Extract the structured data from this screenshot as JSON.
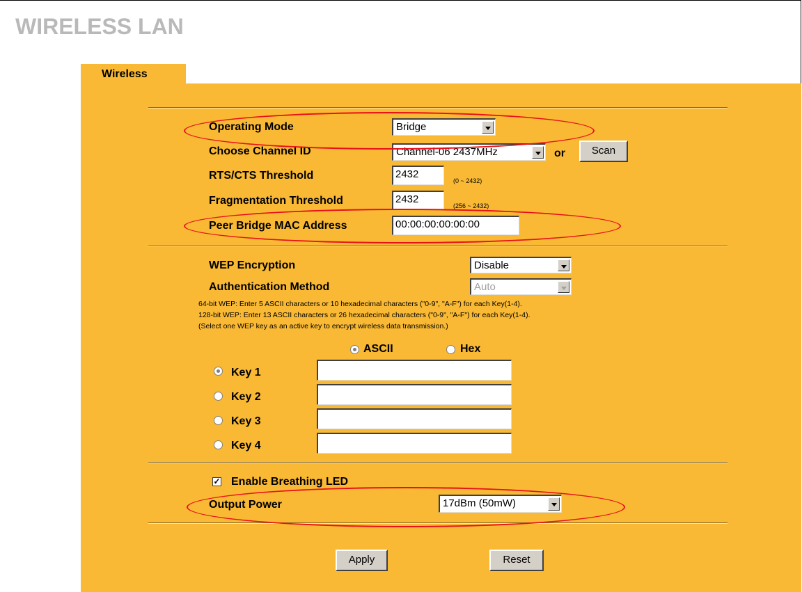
{
  "page": {
    "title": "WIRELESS LAN"
  },
  "tabs": [
    {
      "label": "Wireless"
    }
  ],
  "wireless": {
    "operating_mode_label": "Operating Mode",
    "operating_mode_value": "Bridge",
    "channel_label": "Choose Channel ID",
    "channel_value": "Channel-06 2437MHz",
    "or_text": "or",
    "scan_label": "Scan",
    "rts_label": "RTS/CTS Threshold",
    "rts_value": "2432",
    "rts_range": "(0 ~ 2432)",
    "frag_label": "Fragmentation Threshold",
    "frag_value": "2432",
    "frag_range": "(256 ~ 2432)",
    "peer_mac_label": "Peer Bridge MAC Address",
    "peer_mac_value": "00:00:00:00:00:00"
  },
  "security": {
    "wep_label": "WEP Encryption",
    "wep_value": "Disable",
    "auth_label": "Authentication Method",
    "auth_value": "Auto",
    "note_64": "64-bit WEP: Enter 5 ASCII characters or 10 hexadecimal characters (\"0-9\", \"A-F\") for each Key(1-4).",
    "note_128": "128-bit WEP: Enter 13 ASCII characters or 26 hexadecimal characters (\"0-9\", \"A-F\") for each Key(1-4).",
    "note_select": "(Select one WEP key as an active key to encrypt wireless data transmission.)",
    "format_ascii": "ASCII",
    "format_hex": "Hex",
    "format_selected": "ASCII",
    "keys": [
      {
        "label": "Key 1",
        "value": "",
        "selected": true
      },
      {
        "label": "Key 2",
        "value": "",
        "selected": false
      },
      {
        "label": "Key 3",
        "value": "",
        "selected": false
      },
      {
        "label": "Key 4",
        "value": "",
        "selected": false
      }
    ]
  },
  "led": {
    "label": "Enable Breathing LED",
    "checked": true
  },
  "power": {
    "label": "Output Power",
    "value": "17dBm (50mW)"
  },
  "buttons": {
    "apply": "Apply",
    "reset": "Reset"
  },
  "annotations": {
    "highlight_color": "#e8101a"
  }
}
